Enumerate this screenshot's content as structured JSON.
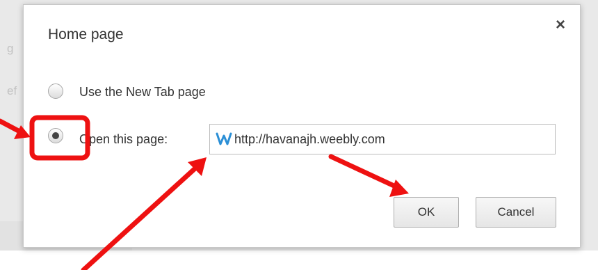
{
  "background": {
    "fragments": [
      "g",
      "ef"
    ]
  },
  "dialog": {
    "title": "Home page",
    "close_glyph": "×",
    "options": [
      {
        "label": "Use the New Tab page",
        "selected": false
      },
      {
        "label": "Open this page:",
        "selected": true
      }
    ],
    "url_input": {
      "value": "http://havanajh.weebly.com",
      "favicon": "weebly-w-icon"
    },
    "buttons": {
      "ok_label": "OK",
      "cancel_label": "Cancel"
    }
  },
  "annotation": {
    "color": "#ee1111",
    "arrows": [
      "arrow-to-radio",
      "arrow-to-url-input",
      "arrow-to-ok-button"
    ],
    "highlight": "radio-highlight-box"
  }
}
